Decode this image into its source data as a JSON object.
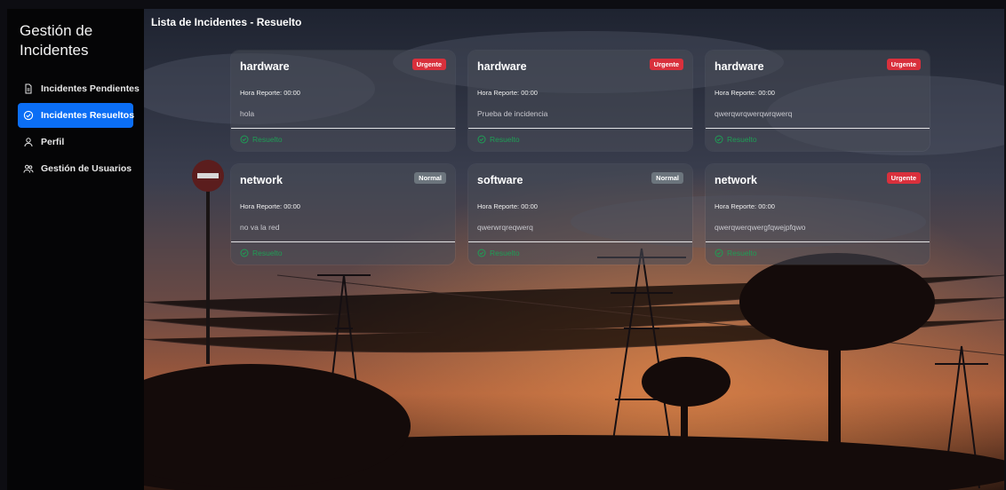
{
  "sidebar": {
    "brand": "Gestión de Incidentes",
    "items": [
      {
        "label": "Incidentes Pendientes",
        "icon": "file-icon",
        "active": false
      },
      {
        "label": "Incidentes Resueltos",
        "icon": "check-circle-icon",
        "active": true
      },
      {
        "label": "Perfil",
        "icon": "user-icon",
        "active": false
      },
      {
        "label": "Gestión de Usuarios",
        "icon": "users-icon",
        "active": false
      }
    ]
  },
  "main": {
    "title": "Lista de Incidentes - Resuelto",
    "cards": [
      {
        "title": "hardware",
        "badge": "Urgente",
        "time": "Hora Reporte: 00:00",
        "description": "hola",
        "status": "Resuelto"
      },
      {
        "title": "hardware",
        "badge": "Urgente",
        "time": "Hora Reporte: 00:00",
        "description": "Prueba de incidencia",
        "status": "Resuelto"
      },
      {
        "title": "hardware",
        "badge": "Urgente",
        "time": "Hora Reporte: 00:00",
        "description": "qwerqwrqwerqwrqwerq",
        "status": "Resuelto"
      },
      {
        "title": "network",
        "badge": "Normal",
        "time": "Hora Reporte: 00:00",
        "description": "no va la red",
        "status": "Resuelto"
      },
      {
        "title": "software",
        "badge": "Normal",
        "time": "Hora Reporte: 00:00",
        "description": "qwerwrqreqwerq",
        "status": "Resuelto"
      },
      {
        "title": "network",
        "badge": "Urgente",
        "time": "Hora Reporte: 00:00",
        "description": "qwerqwerqwergfqwejpfqwo",
        "status": "Resuelto"
      }
    ]
  },
  "colors": {
    "accent": "#0b6ef5",
    "urgent": "#d9303c",
    "normal": "#6c757d",
    "resolved": "#1f9d55"
  }
}
